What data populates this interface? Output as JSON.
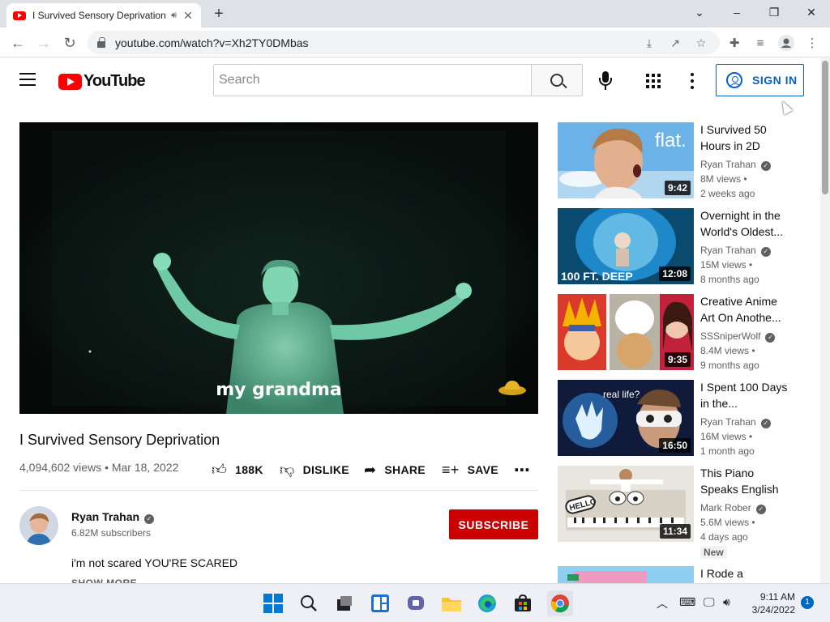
{
  "browser": {
    "tab_title": "I Survived Sensory Deprivation",
    "url": "youtube.com/watch?v=Xh2TY0DMbas"
  },
  "youtube": {
    "logo_text": "YouTube",
    "search_placeholder": "Search",
    "sign_in": "SIGN IN"
  },
  "video": {
    "subtitle": "my grandma",
    "title": "I Survived Sensory Deprivation",
    "views_date": "4,094,602 views • Mar 18, 2022",
    "likes": "188K",
    "dislike": "DISLIKE",
    "share": "SHARE",
    "save": "SAVE"
  },
  "channel": {
    "name": "Ryan Trahan",
    "subscribers": "6.82M subscribers",
    "subscribe": "SUBSCRIBE",
    "description": "i'm not scared YOU'RE SCARED",
    "show_more": "SHOW MORE"
  },
  "related": [
    {
      "title": "I Survived 50 Hours in 2D",
      "channel": "Ryan Trahan",
      "views": "8M views •",
      "age": "2 weeks ago",
      "duration": "9:42",
      "thumb_text": "flat."
    },
    {
      "title": "Overnight in the World's Oldest...",
      "channel": "Ryan Trahan",
      "views": "15M views •",
      "age": "8 months ago",
      "duration": "12:08",
      "thumb_text": "100 FT. DEEP"
    },
    {
      "title": "Creative Anime Art On Anothe...",
      "channel": "SSSniperWolf",
      "views": "8.4M views •",
      "age": "9 months ago",
      "duration": "9:35",
      "thumb_text": ""
    },
    {
      "title": "I Spent 100 Days in the...",
      "channel": "Ryan Trahan",
      "views": "16M views •",
      "age": "1 month ago",
      "duration": "16:50",
      "thumb_text": "real life?"
    },
    {
      "title": "This Piano Speaks English",
      "channel": "Mark Rober",
      "views": "5.6M views •",
      "age": "4 days ago",
      "duration": "11:34",
      "thumb_text": "HELLO"
    },
    {
      "title": "I Rode a",
      "channel": "",
      "views": "",
      "age": "",
      "duration": "",
      "thumb_text": ""
    }
  ],
  "new_badge": "New",
  "taskbar": {
    "time": "9:11 AM",
    "date": "3/24/2022",
    "notifications": "1"
  },
  "colors": {
    "yt_red": "#ff0000",
    "subscribe_red": "#cc0000",
    "signin_blue": "#065fd4",
    "night_vision_green": "#7fd6b0"
  }
}
